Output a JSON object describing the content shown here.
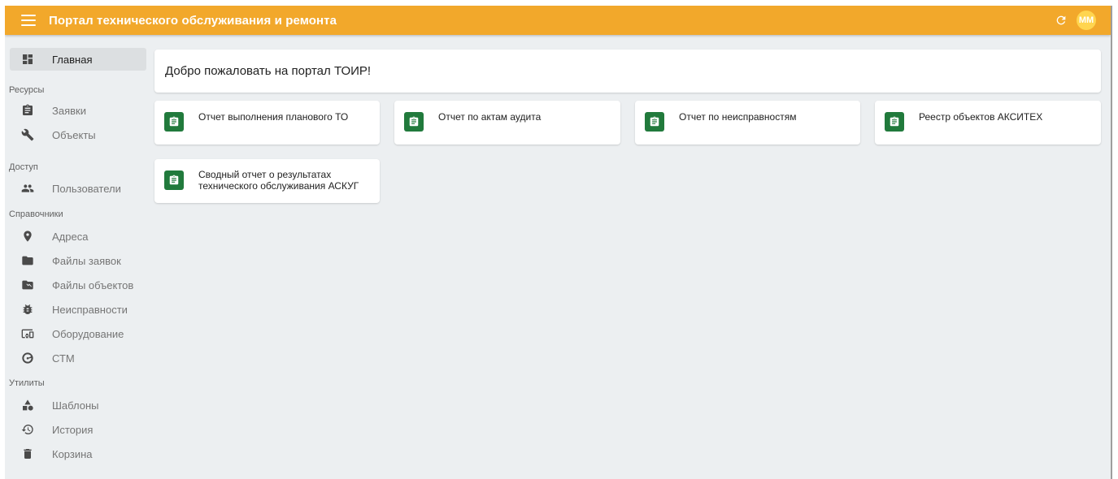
{
  "app": {
    "title": "Портал технического обслуживания и ремонта",
    "avatar_initials": "MM"
  },
  "header": {
    "menu_icon": "menu-icon",
    "refresh_icon": "refresh-icon",
    "colors": {
      "bar": "#f2a82b",
      "avatar": "#ffd54f"
    }
  },
  "sidebar": {
    "home": {
      "label": "Главная",
      "icon": "dashboard-icon"
    },
    "sections": {
      "resources": "Ресурсы",
      "access": "Доступ",
      "references": "Справочники",
      "utilities": "Утилиты"
    },
    "items": {
      "requests": {
        "label": "Заявки",
        "icon": "clipboard-icon"
      },
      "objects": {
        "label": "Объекты",
        "icon": "wrench-icon"
      },
      "users": {
        "label": "Пользователи",
        "icon": "people-icon"
      },
      "addresses": {
        "label": "Адреса",
        "icon": "location-pin-icon"
      },
      "request_files": {
        "label": "Файлы заявок",
        "icon": "folder-icon"
      },
      "object_files": {
        "label": "Файлы объектов",
        "icon": "folder-special-icon"
      },
      "faults": {
        "label": "Неисправности",
        "icon": "bug-icon"
      },
      "equipment": {
        "label": "Оборудование",
        "icon": "devices-icon"
      },
      "ctm": {
        "label": "СТМ",
        "icon": "gauge-icon"
      },
      "templates": {
        "label": "Шаблоны",
        "icon": "shapes-icon"
      },
      "history": {
        "label": "История",
        "icon": "history-icon"
      },
      "trash": {
        "label": "Корзина",
        "icon": "trash-icon"
      }
    }
  },
  "main": {
    "welcome": "Добро пожаловать на портал ТОИР!",
    "cards": [
      {
        "label": "Отчет выполнения планового ТО",
        "icon": "assignment-icon"
      },
      {
        "label": "Отчет по актам аудита",
        "icon": "assignment-icon"
      },
      {
        "label": "Отчет по неисправностям",
        "icon": "assignment-icon"
      },
      {
        "label": "Реестр объектов АКСИТЕХ",
        "icon": "assignment-icon"
      },
      {
        "label": "Сводный отчет о результатах технического обслуживания АСКУГ",
        "icon": "assignment-icon"
      }
    ],
    "card_icon_color": "#217a3c"
  }
}
